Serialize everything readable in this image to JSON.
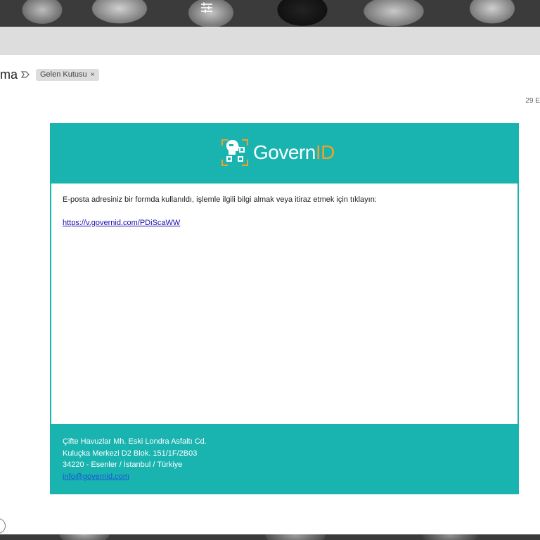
{
  "header": {
    "subject_tail": "ma",
    "label_chip": "Gelen Kutusu",
    "chip_remove": "×",
    "date_tail": "29 E"
  },
  "email": {
    "brand": {
      "name_main": "Govern",
      "name_accent": "ID",
      "accent_color": "#f0a129",
      "brand_color": "#1ab4b0"
    },
    "body_text": "E-posta adresiniz bir formda kullanıldı, işlemle ilgili bilgi almak veya itiraz etmek için tıklayın:",
    "link": "https://v.governid.com/PDiScaWW",
    "footer": {
      "line1": "Çifte Havuzlar Mh. Eski Londra Asfaltı Cd.",
      "line2": "Kuluçka Merkezi D2 Blok. 151/1F/2B03",
      "line3": "34220 - Esenler / İstanbul / Türkiye",
      "email": "info@governid.com"
    }
  },
  "icons": [
    "filter-sliders-icon",
    "label-arrow-icon",
    "close-icon",
    "governid-logo-icon"
  ]
}
